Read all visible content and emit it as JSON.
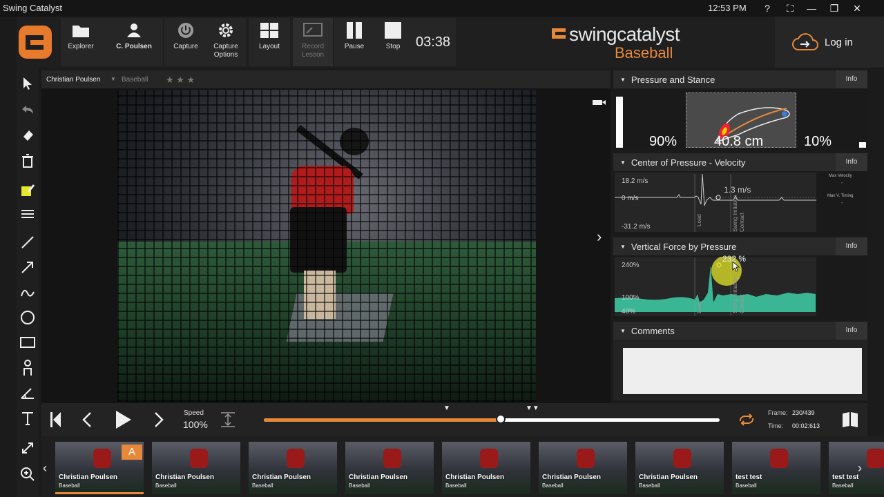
{
  "titlebar": {
    "app_title": "Swing Catalyst",
    "clock": "12:53 PM",
    "help": "?",
    "fit": "⛶",
    "minimize": "—",
    "maximize": "❐",
    "close": "✕"
  },
  "ribbon": {
    "explorer": "Explorer",
    "user": "C. Poulsen",
    "capture": "Capture",
    "capture_options_1": "Capture",
    "capture_options_2": "Options",
    "layout": "Layout",
    "record_lesson_1": "Record",
    "record_lesson_2": "Lesson",
    "pause": "Pause",
    "stop": "Stop",
    "timer": "03:38",
    "brand_name": "swingcatalyst",
    "brand_sub": "Baseball",
    "login": "Log in"
  },
  "video": {
    "athlete": "Christian Poulsen",
    "sport": "Baseball",
    "rating_stars": "★ ★ ★"
  },
  "panels": {
    "pressure_stance": {
      "title": "Pressure and Stance",
      "info": "Info",
      "left_pct": "90%",
      "right_pct": "10%",
      "distance": "40.8 cm"
    },
    "cop_velocity": {
      "title": "Center of Pressure - Velocity",
      "info": "Info",
      "y_top": "18.2 m/s",
      "y_zero": "0 m/s",
      "y_bottom": "-31.2 m/s",
      "readout": "1.3 m/s",
      "label_load": "Load",
      "label_swing": "Swing Initiation",
      "label_contact": "Contact",
      "side_max_velocity": "Max Velocity",
      "side_max_v_timing": "Max V. Timing",
      "side_dash1": "-",
      "side_dash2": "-"
    },
    "vertical_force": {
      "title": "Vertical Force by Pressure",
      "info": "Info",
      "y_top": "240%",
      "y_mid": "100%",
      "y_bottom": "40%",
      "readout": "232 %",
      "label_load": "Load",
      "label_swing": "Swing Initiation",
      "label_contact": "Contact"
    },
    "comments": {
      "title": "Comments",
      "info": "Info"
    }
  },
  "transport": {
    "speed_label": "Speed",
    "speed_value": "100%",
    "progress": 0.52,
    "frame_label": "Frame:",
    "frame_value": "230/439",
    "time_label": "Time:",
    "time_value": "00:02:613"
  },
  "thumbnails": [
    {
      "name": "Christian Poulsen",
      "sport": "Baseball",
      "badge": "A"
    },
    {
      "name": "Christian Poulsen",
      "sport": "Baseball",
      "badge": ""
    },
    {
      "name": "Christian Poulsen",
      "sport": "Baseball",
      "badge": ""
    },
    {
      "name": "Christian Poulsen",
      "sport": "Baseball",
      "badge": ""
    },
    {
      "name": "Christian Poulsen",
      "sport": "Baseball",
      "badge": ""
    },
    {
      "name": "Christian Poulsen",
      "sport": "Baseball",
      "badge": ""
    },
    {
      "name": "Christian Poulsen",
      "sport": "Baseball",
      "badge": ""
    },
    {
      "name": "test test",
      "sport": "Baseball",
      "badge": ""
    },
    {
      "name": "test test",
      "sport": "Baseball",
      "badge": ""
    }
  ],
  "colors": {
    "accent": "#e8893a",
    "chart_line": "#3fd0a8",
    "highlight": "#e6e62a"
  }
}
